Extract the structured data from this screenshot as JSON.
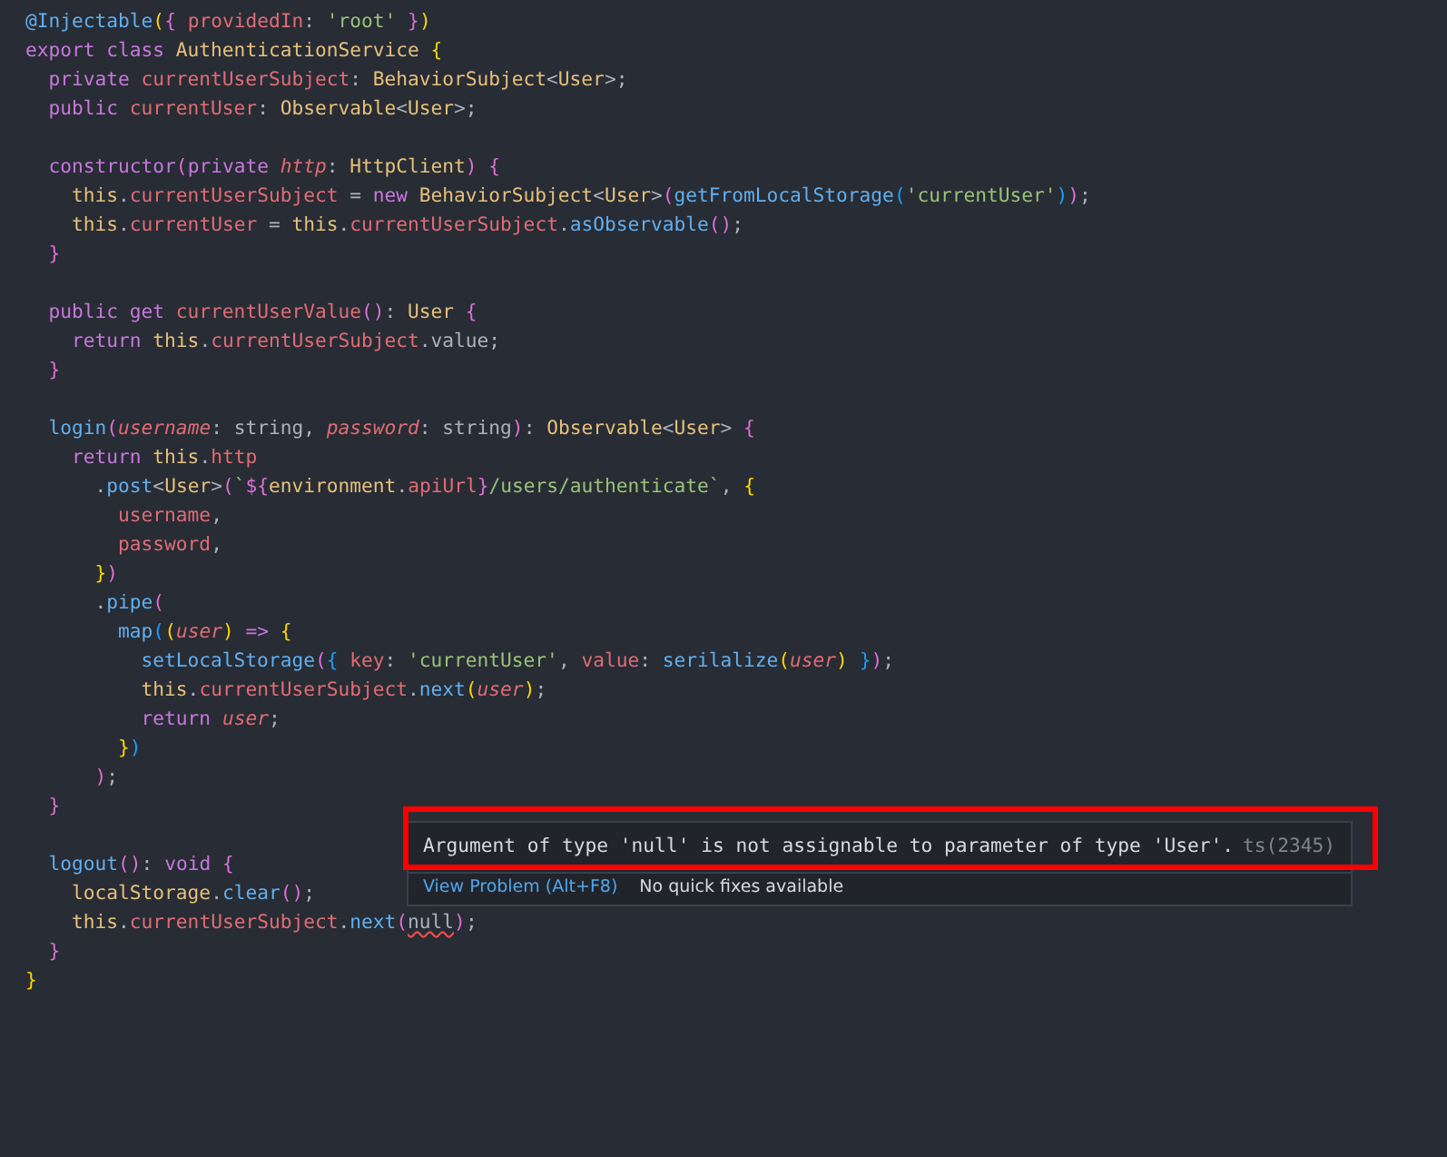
{
  "editor": {
    "lines": [
      {
        "kind": "code",
        "tokens": [
          {
            "text": "@Injectable",
            "kind": "fn"
          },
          {
            "text": "(",
            "kind": "b1"
          },
          {
            "text": "{",
            "kind": "b2"
          },
          {
            "text": " providedIn",
            "kind": "prop"
          },
          {
            "text": ": ",
            "kind": "p"
          },
          {
            "text": "'root'",
            "kind": "str"
          },
          {
            "text": " }",
            "kind": "b2"
          },
          {
            "text": ")",
            "kind": "b1"
          }
        ]
      },
      {
        "kind": "code",
        "tokens": [
          {
            "text": "export class ",
            "kind": "kw"
          },
          {
            "text": "AuthenticationService ",
            "kind": "type"
          },
          {
            "text": "{",
            "kind": "b1"
          }
        ]
      },
      {
        "kind": "code",
        "tokens": [
          {
            "text": "  private ",
            "kind": "kw"
          },
          {
            "text": "currentUserSubject",
            "kind": "prop"
          },
          {
            "text": ": ",
            "kind": "p"
          },
          {
            "text": "BehaviorSubject",
            "kind": "type"
          },
          {
            "text": "<",
            "kind": "p"
          },
          {
            "text": "User",
            "kind": "type"
          },
          {
            "text": ">;",
            "kind": "p"
          }
        ]
      },
      {
        "kind": "code",
        "tokens": [
          {
            "text": "  public ",
            "kind": "kw"
          },
          {
            "text": "currentUser",
            "kind": "prop"
          },
          {
            "text": ": ",
            "kind": "p"
          },
          {
            "text": "Observable",
            "kind": "type"
          },
          {
            "text": "<",
            "kind": "p"
          },
          {
            "text": "User",
            "kind": "type"
          },
          {
            "text": ">;",
            "kind": "p"
          }
        ]
      },
      {
        "kind": "blank"
      },
      {
        "kind": "code",
        "tokens": [
          {
            "text": "  constructor",
            "kind": "kw"
          },
          {
            "text": "(",
            "kind": "b2"
          },
          {
            "text": "private ",
            "kind": "kw"
          },
          {
            "text": "http",
            "kind": "param"
          },
          {
            "text": ": ",
            "kind": "p"
          },
          {
            "text": "HttpClient",
            "kind": "type"
          },
          {
            "text": ") ",
            "kind": "b2"
          },
          {
            "text": "{",
            "kind": "b2"
          }
        ]
      },
      {
        "kind": "code",
        "tokens": [
          {
            "text": "    this",
            "kind": "this"
          },
          {
            "text": ".",
            "kind": "p"
          },
          {
            "text": "currentUserSubject",
            "kind": "prop"
          },
          {
            "text": " = ",
            "kind": "p"
          },
          {
            "text": "new ",
            "kind": "kw"
          },
          {
            "text": "BehaviorSubject",
            "kind": "type"
          },
          {
            "text": "<",
            "kind": "p"
          },
          {
            "text": "User",
            "kind": "type"
          },
          {
            "text": ">",
            "kind": "p"
          },
          {
            "text": "(",
            "kind": "b2"
          },
          {
            "text": "getFromLocalStorage",
            "kind": "fn"
          },
          {
            "text": "(",
            "kind": "b3"
          },
          {
            "text": "'currentUser'",
            "kind": "str"
          },
          {
            "text": ")",
            "kind": "b3"
          },
          {
            "text": ")",
            "kind": "b2"
          },
          {
            "text": ";",
            "kind": "p"
          }
        ]
      },
      {
        "kind": "code",
        "tokens": [
          {
            "text": "    this",
            "kind": "this"
          },
          {
            "text": ".",
            "kind": "p"
          },
          {
            "text": "currentUser",
            "kind": "prop"
          },
          {
            "text": " = ",
            "kind": "p"
          },
          {
            "text": "this",
            "kind": "this"
          },
          {
            "text": ".",
            "kind": "p"
          },
          {
            "text": "currentUserSubject",
            "kind": "prop"
          },
          {
            "text": ".",
            "kind": "p"
          },
          {
            "text": "asObservable",
            "kind": "fn"
          },
          {
            "text": "()",
            "kind": "b2"
          },
          {
            "text": ";",
            "kind": "p"
          }
        ]
      },
      {
        "kind": "code",
        "tokens": [
          {
            "text": "  }",
            "kind": "b2"
          }
        ]
      },
      {
        "kind": "blank"
      },
      {
        "kind": "code",
        "tokens": [
          {
            "text": "  public get ",
            "kind": "kw"
          },
          {
            "text": "currentUserValue",
            "kind": "prop"
          },
          {
            "text": "()",
            "kind": "b2"
          },
          {
            "text": ": ",
            "kind": "p"
          },
          {
            "text": "User ",
            "kind": "type"
          },
          {
            "text": "{",
            "kind": "b2"
          }
        ]
      },
      {
        "kind": "code",
        "tokens": [
          {
            "text": "    return ",
            "kind": "kw"
          },
          {
            "text": "this",
            "kind": "this"
          },
          {
            "text": ".",
            "kind": "p"
          },
          {
            "text": "currentUserSubject",
            "kind": "prop"
          },
          {
            "text": ".value;",
            "kind": "p"
          }
        ]
      },
      {
        "kind": "code",
        "tokens": [
          {
            "text": "  }",
            "kind": "b2"
          }
        ]
      },
      {
        "kind": "blank"
      },
      {
        "kind": "code",
        "tokens": [
          {
            "text": "  login",
            "kind": "fn"
          },
          {
            "text": "(",
            "kind": "b2"
          },
          {
            "text": "username",
            "kind": "param"
          },
          {
            "text": ": string, ",
            "kind": "p"
          },
          {
            "text": "password",
            "kind": "param"
          },
          {
            "text": ": string",
            "kind": "p"
          },
          {
            "text": ")",
            "kind": "b2"
          },
          {
            "text": ": ",
            "kind": "p"
          },
          {
            "text": "Observable",
            "kind": "type"
          },
          {
            "text": "<",
            "kind": "p"
          },
          {
            "text": "User",
            "kind": "type"
          },
          {
            "text": "> ",
            "kind": "p"
          },
          {
            "text": "{",
            "kind": "b2"
          }
        ]
      },
      {
        "kind": "code",
        "tokens": [
          {
            "text": "    return ",
            "kind": "kw"
          },
          {
            "text": "this",
            "kind": "this"
          },
          {
            "text": ".",
            "kind": "p"
          },
          {
            "text": "http",
            "kind": "prop"
          }
        ]
      },
      {
        "kind": "code",
        "tokens": [
          {
            "text": "      .",
            "kind": "p"
          },
          {
            "text": "post",
            "kind": "fn"
          },
          {
            "text": "<",
            "kind": "p"
          },
          {
            "text": "User",
            "kind": "type"
          },
          {
            "text": ">",
            "kind": "p"
          },
          {
            "text": "(",
            "kind": "b2"
          },
          {
            "text": "`",
            "kind": "str"
          },
          {
            "text": "${",
            "kind": "b2"
          },
          {
            "text": "environment",
            "kind": "this"
          },
          {
            "text": ".",
            "kind": "p"
          },
          {
            "text": "apiUrl",
            "kind": "prop"
          },
          {
            "text": "}",
            "kind": "b2"
          },
          {
            "text": "/users/authenticate`",
            "kind": "str"
          },
          {
            "text": ", ",
            "kind": "p"
          },
          {
            "text": "{",
            "kind": "b1"
          }
        ]
      },
      {
        "kind": "code",
        "tokens": [
          {
            "text": "        username",
            "kind": "prop"
          },
          {
            "text": ",",
            "kind": "p"
          }
        ]
      },
      {
        "kind": "code",
        "tokens": [
          {
            "text": "        password",
            "kind": "prop"
          },
          {
            "text": ",",
            "kind": "p"
          }
        ]
      },
      {
        "kind": "code",
        "tokens": [
          {
            "text": "      }",
            "kind": "b1"
          },
          {
            "text": ")",
            "kind": "b2"
          }
        ]
      },
      {
        "kind": "code",
        "tokens": [
          {
            "text": "      .",
            "kind": "p"
          },
          {
            "text": "pipe",
            "kind": "fn"
          },
          {
            "text": "(",
            "kind": "b2"
          }
        ]
      },
      {
        "kind": "code",
        "tokens": [
          {
            "text": "        map",
            "kind": "fn"
          },
          {
            "text": "(",
            "kind": "b3"
          },
          {
            "text": "(",
            "kind": "b1"
          },
          {
            "text": "user",
            "kind": "param"
          },
          {
            "text": ")",
            "kind": "b1"
          },
          {
            "text": " => ",
            "kind": "kw"
          },
          {
            "text": "{",
            "kind": "b1"
          }
        ]
      },
      {
        "kind": "code",
        "tokens": [
          {
            "text": "          setLocalStorage",
            "kind": "fn"
          },
          {
            "text": "(",
            "kind": "b2"
          },
          {
            "text": "{",
            "kind": "b3"
          },
          {
            "text": " key",
            "kind": "prop"
          },
          {
            "text": ": ",
            "kind": "p"
          },
          {
            "text": "'currentUser'",
            "kind": "str"
          },
          {
            "text": ", ",
            "kind": "p"
          },
          {
            "text": "value",
            "kind": "prop"
          },
          {
            "text": ": ",
            "kind": "p"
          },
          {
            "text": "serilalize",
            "kind": "fn"
          },
          {
            "text": "(",
            "kind": "b1"
          },
          {
            "text": "user",
            "kind": "param"
          },
          {
            "text": ")",
            "kind": "b1"
          },
          {
            "text": " }",
            "kind": "b3"
          },
          {
            "text": ")",
            "kind": "b2"
          },
          {
            "text": ";",
            "kind": "p"
          }
        ]
      },
      {
        "kind": "code",
        "tokens": [
          {
            "text": "          this",
            "kind": "this"
          },
          {
            "text": ".",
            "kind": "p"
          },
          {
            "text": "currentUserSubject",
            "kind": "prop"
          },
          {
            "text": ".",
            "kind": "p"
          },
          {
            "text": "next",
            "kind": "fn"
          },
          {
            "text": "(",
            "kind": "b1"
          },
          {
            "text": "user",
            "kind": "param"
          },
          {
            "text": ")",
            "kind": "b1"
          },
          {
            "text": ";",
            "kind": "p"
          }
        ]
      },
      {
        "kind": "code",
        "tokens": [
          {
            "text": "          return ",
            "kind": "kw"
          },
          {
            "text": "user",
            "kind": "param"
          },
          {
            "text": ";",
            "kind": "p"
          }
        ]
      },
      {
        "kind": "code",
        "tokens": [
          {
            "text": "        }",
            "kind": "b1"
          },
          {
            "text": ")",
            "kind": "b3"
          }
        ]
      },
      {
        "kind": "code",
        "tokens": [
          {
            "text": "      )",
            "kind": "b2"
          },
          {
            "text": ";",
            "kind": "p"
          }
        ]
      },
      {
        "kind": "code",
        "tokens": [
          {
            "text": "  }",
            "kind": "b2"
          }
        ]
      },
      {
        "kind": "blank"
      },
      {
        "kind": "code",
        "tokens": [
          {
            "text": "  logout",
            "kind": "fn"
          },
          {
            "text": "()",
            "kind": "b2"
          },
          {
            "text": ": ",
            "kind": "p"
          },
          {
            "text": "void ",
            "kind": "kw"
          },
          {
            "text": "{",
            "kind": "b2"
          }
        ]
      },
      {
        "kind": "code",
        "tokens": [
          {
            "text": "    localStorage",
            "kind": "this"
          },
          {
            "text": ".",
            "kind": "p"
          },
          {
            "text": "clear",
            "kind": "fn"
          },
          {
            "text": "()",
            "kind": "b2"
          },
          {
            "text": ";",
            "kind": "p"
          }
        ]
      },
      {
        "kind": "code",
        "tokens": [
          {
            "text": "    this",
            "kind": "this"
          },
          {
            "text": ".",
            "kind": "p"
          },
          {
            "text": "currentUserSubject",
            "kind": "prop"
          },
          {
            "text": ".",
            "kind": "p"
          },
          {
            "text": "next",
            "kind": "fn"
          },
          {
            "text": "(",
            "kind": "b2"
          },
          {
            "text": "null",
            "kind": "err"
          },
          {
            "text": ")",
            "kind": "b2"
          },
          {
            "text": ";",
            "kind": "p"
          }
        ]
      },
      {
        "kind": "code",
        "tokens": [
          {
            "text": "  }",
            "kind": "b2"
          }
        ]
      },
      {
        "kind": "code",
        "tokens": [
          {
            "text": "}",
            "kind": "b1"
          }
        ]
      }
    ]
  },
  "hover": {
    "message": "Argument of type 'null' is not assignable to parameter of type 'User'.",
    "code": "ts(2345)",
    "link": "View Problem (Alt+F8)",
    "note": "No quick fixes available"
  }
}
